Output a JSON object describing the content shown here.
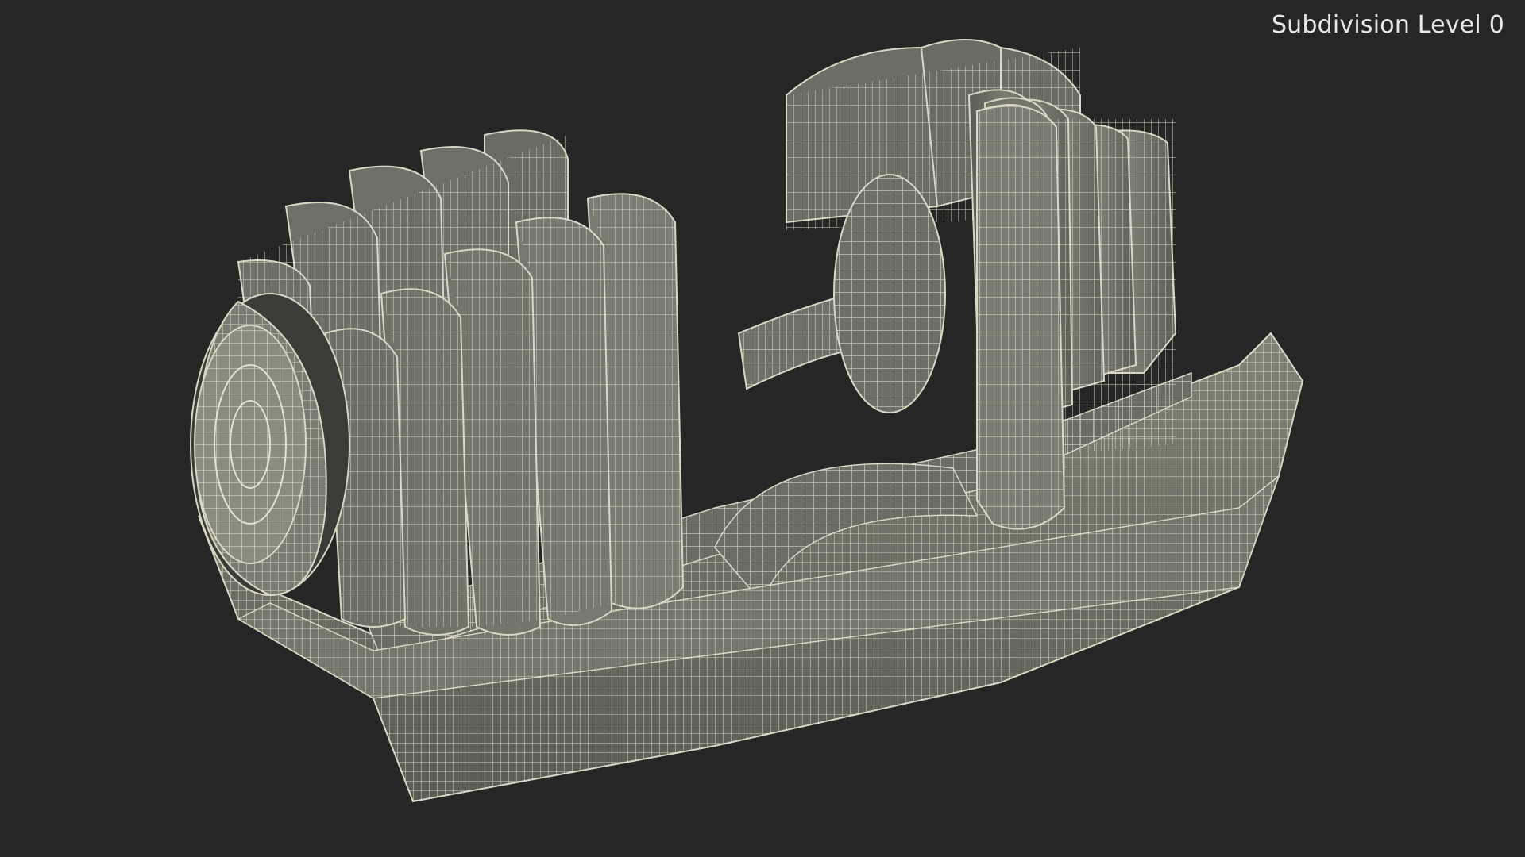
{
  "overlay": {
    "subdivision_label": "Subdivision Level 0"
  },
  "colors": {
    "background": "#262626",
    "surface": "#6f7168",
    "surface_light": "#858779",
    "surface_dark": "#4a4b44",
    "wire": "#e4e2cf",
    "label": "#e8e8e8"
  },
  "scene": {
    "object": "adjustable-dumbbell-in-tray",
    "render_style": "wireframe-over-shaded"
  }
}
